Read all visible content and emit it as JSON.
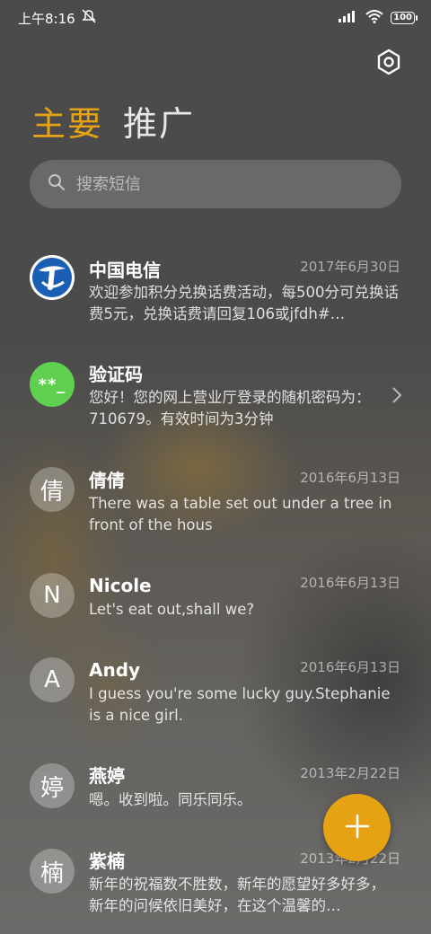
{
  "status_bar": {
    "time": "上午8:16",
    "battery": "100",
    "icons": [
      "mute-icon",
      "signal-icon",
      "wifi-icon",
      "battery-icon"
    ]
  },
  "header": {
    "settings_icon": "settings-icon",
    "tabs": [
      {
        "label": "主要",
        "active": true
      },
      {
        "label": "推广",
        "active": false
      }
    ]
  },
  "search": {
    "placeholder": "搜索短信",
    "value": ""
  },
  "conversations": [
    {
      "name": "中国电信",
      "date": "2017年6月30日",
      "preview": "欢迎参加积分兑换话费活动，每500分可兑换话费5元，兑换话费请回复106或jfdh#…",
      "avatar": "",
      "avatar_type": "logo"
    },
    {
      "name": "验证码",
      "date": "",
      "preview": "您好！您的网上营业厅登录的随机密码为：710679。有效时间为3分钟",
      "avatar": "**_",
      "avatar_type": "code"
    },
    {
      "name": "倩倩",
      "date": "2016年6月13日",
      "preview": "There was a table set out under a tree in front of the hous",
      "avatar": "倩",
      "avatar_type": "initial"
    },
    {
      "name": "Nicole",
      "date": "2016年6月13日",
      "preview": "Let's eat out,shall we?",
      "avatar": "N",
      "avatar_type": "initial"
    },
    {
      "name": "Andy",
      "date": "2016年6月13日",
      "preview": "I guess you're some lucky guy.Stephanie is a nice girl.",
      "avatar": "A",
      "avatar_type": "initial"
    },
    {
      "name": "燕婷",
      "date": "2013年2月22日",
      "preview": "嗯。收到啦。同乐同乐。",
      "avatar": "婷",
      "avatar_type": "initial"
    },
    {
      "name": "紫楠",
      "date": "2013年2月22日",
      "preview": "新年的祝福数不胜数，新年的愿望好多好多，新年的问候依旧美好，在这个温馨的…",
      "avatar": "楠",
      "avatar_type": "initial"
    }
  ],
  "fab": {
    "icon": "plus-icon"
  },
  "colors": {
    "accent": "#e5a213",
    "telecom_blue": "#1b5fb5",
    "code_green": "#5ecf4f"
  }
}
